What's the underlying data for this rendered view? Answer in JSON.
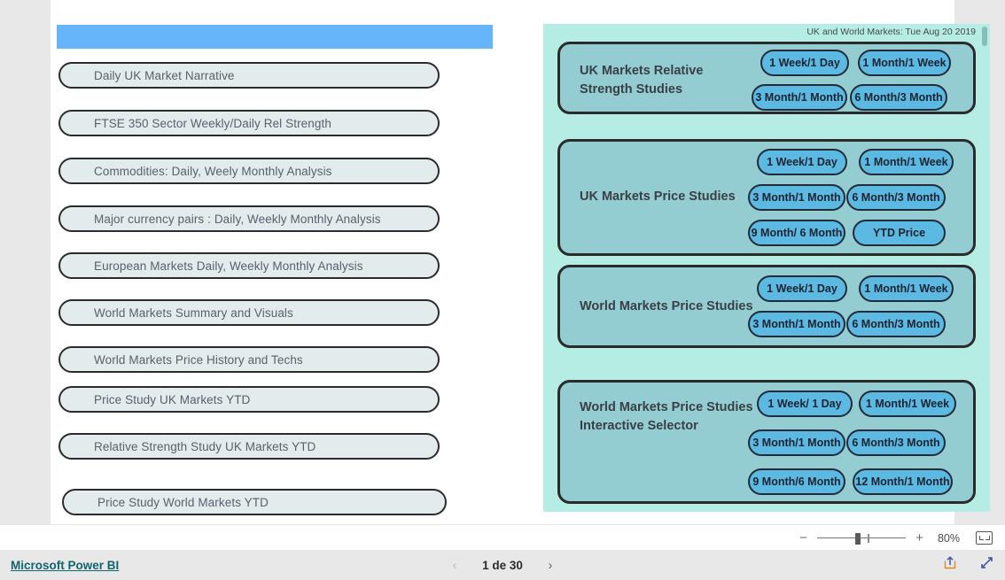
{
  "left_panel": {
    "nav_items": [
      {
        "label": "Daily  UK Market Narrative"
      },
      {
        "label": "FTSE 350 Sector Weekly/Daily Rel Strength"
      },
      {
        "label": "Commodities: Daily, Weely Monthly  Analysis"
      },
      {
        "label": "Major currency pairs : Daily, Weekly Monthly  Analysis"
      },
      {
        "label": "European Markets Daily, Weekly Monthly  Analysis"
      },
      {
        "label": "World Markets Summary and Visuals"
      },
      {
        "label": "World Markets Price History and Techs"
      },
      {
        "label": "Price Study UK Markets YTD"
      },
      {
        "label": "Relative Strength Study UK Markets YTD"
      },
      {
        "label": "Price Study World  Markets YTD"
      }
    ]
  },
  "right_panel": {
    "date_label": "UK and World Markets: Tue Aug 20 2019",
    "cards": [
      {
        "title": "UK Markets Relative Strength Studies",
        "buttons": [
          "1 Week/1 Day",
          "1 Month/1 Week",
          "3 Month/1 Month",
          "6 Month/3 Month"
        ]
      },
      {
        "title": "UK Markets Price Studies",
        "buttons": [
          "1 Week/1 Day",
          "1 Month/1 Week",
          "3 Month/1 Month",
          "6 Month/3 Month",
          "9 Month/ 6 Month",
          "YTD Price"
        ]
      },
      {
        "title": "World Markets Price Studies",
        "buttons": [
          "1 Week/1 Day",
          "1 Month/1 Week",
          "3 Month/1 Month",
          "6 Month/3 Month"
        ]
      },
      {
        "title": "World Markets Price Studies\nInteractive Selector",
        "buttons": [
          "1 Week/ 1 Day",
          "1 Month/1 Week",
          "3 Month/1 Month",
          "6 Month/3 Month",
          "9 Month/6 Month",
          "12 Month/1 Month"
        ]
      }
    ]
  },
  "zoom_bar": {
    "minus_label": "−",
    "plus_label": "+",
    "percent": "80%"
  },
  "footer": {
    "brand_link": "Microsoft Power BI",
    "prev_label": "‹",
    "page_label": "1 de 30",
    "next_label": "›"
  },
  "colors": {
    "blue_header": "#66b5fb",
    "mint_panel": "#b5ece4",
    "card_fill": "#93cdd1",
    "button_fill": "#5cb9e2",
    "pill_fill": "#e3ebed",
    "brand_link": "#10656e"
  }
}
